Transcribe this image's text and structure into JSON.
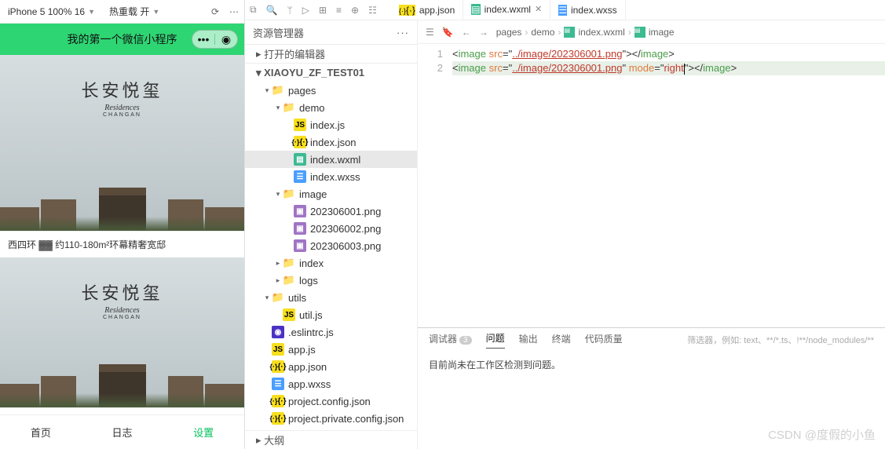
{
  "simulator": {
    "device": "iPhone 5 100% 16",
    "hotreload": "热重载 开",
    "title": "我的第一个微信小程序",
    "card_title_cn": "长安悦玺",
    "card_title_en": "Residences",
    "card_title_sub": "CHANGAN",
    "card2_caption": "西四环 ▓▓ 约110-180m²环幕精奢宽邸",
    "tabs": [
      "首页",
      "日志",
      "设置"
    ],
    "tab_active": 2
  },
  "ide_toolbar_tabs": [
    {
      "icon": "json",
      "label": "app.json",
      "active": false
    },
    {
      "icon": "wxml",
      "label": "index.wxml",
      "active": true,
      "close": true
    },
    {
      "icon": "wxss",
      "label": "index.wxss",
      "active": false
    }
  ],
  "explorer": {
    "title": "资源管理器",
    "open_editors": "打开的编辑器",
    "project": "XIAOYU_ZF_TEST01",
    "outline": "大纲",
    "tree": [
      {
        "d": 1,
        "exp": true,
        "icon": "folder-blue",
        "label": "pages"
      },
      {
        "d": 2,
        "exp": true,
        "icon": "folder-blue",
        "label": "demo"
      },
      {
        "d": 3,
        "icon": "js",
        "label": "index.js"
      },
      {
        "d": 3,
        "icon": "json",
        "label": "index.json"
      },
      {
        "d": 3,
        "icon": "wxml",
        "label": "index.wxml",
        "sel": true
      },
      {
        "d": 3,
        "icon": "wxss",
        "label": "index.wxss"
      },
      {
        "d": 2,
        "exp": true,
        "icon": "folder-teal",
        "label": "image"
      },
      {
        "d": 3,
        "icon": "png",
        "label": "202306001.png"
      },
      {
        "d": 3,
        "icon": "png",
        "label": "202306002.png"
      },
      {
        "d": 3,
        "icon": "png",
        "label": "202306003.png"
      },
      {
        "d": 2,
        "exp": false,
        "icon": "folder-gray",
        "label": "index"
      },
      {
        "d": 2,
        "exp": false,
        "icon": "folder-brown",
        "label": "logs"
      },
      {
        "d": 1,
        "exp": true,
        "icon": "folder-teal",
        "label": "utils"
      },
      {
        "d": 2,
        "icon": "js",
        "label": "util.js"
      },
      {
        "d": 1,
        "icon": "eslint",
        "label": ".eslintrc.js"
      },
      {
        "d": 1,
        "icon": "js",
        "label": "app.js"
      },
      {
        "d": 1,
        "icon": "json",
        "label": "app.json"
      },
      {
        "d": 1,
        "icon": "wxss",
        "label": "app.wxss"
      },
      {
        "d": 1,
        "icon": "json",
        "label": "project.config.json"
      },
      {
        "d": 1,
        "icon": "json",
        "label": "project.private.config.json"
      }
    ]
  },
  "breadcrumb": [
    "pages",
    "demo",
    "index.wxml",
    "image"
  ],
  "breadcrumb_icons": [
    "",
    "",
    "wxml",
    "wxml-el"
  ],
  "code_lines": [
    {
      "n": 1,
      "tokens": [
        [
          "punc",
          "<"
        ],
        [
          "tag",
          "image"
        ],
        [
          "",
          ""
        ],
        [
          "",
          " "
        ],
        [
          "attr",
          "src"
        ],
        [
          "punc",
          "="
        ],
        [
          "punc",
          "\""
        ],
        [
          "url",
          "../image/202306001.png"
        ],
        [
          "punc",
          "\""
        ],
        [
          "punc",
          ">"
        ],
        [
          "punc",
          "</"
        ],
        [
          "tag",
          "image"
        ],
        [
          "punc",
          ">"
        ]
      ]
    },
    {
      "n": 2,
      "hl": true,
      "tokens": [
        [
          "punc",
          "<"
        ],
        [
          "tag",
          "image"
        ],
        [
          "",
          " "
        ],
        [
          "attr",
          "src"
        ],
        [
          "punc",
          "="
        ],
        [
          "punc",
          "\""
        ],
        [
          "url",
          "../image/202306001.png"
        ],
        [
          "punc",
          "\""
        ],
        [
          "",
          " "
        ],
        [
          "attr",
          "mode"
        ],
        [
          "punc",
          "="
        ],
        [
          "punc",
          "\""
        ],
        [
          "str",
          "right"
        ],
        [
          "cursor",
          ""
        ],
        [
          "punc",
          "\""
        ],
        [
          "punc",
          ">"
        ],
        [
          "punc",
          "</"
        ],
        [
          "tag",
          "image"
        ],
        [
          "punc",
          ">"
        ]
      ]
    }
  ],
  "bottom_panel": {
    "tabs": [
      "调试器",
      "问题",
      "输出",
      "终端",
      "代码质量"
    ],
    "badge_on": 0,
    "badge": "3",
    "active": 1,
    "filter_placeholder": "筛选器，例如: text、**/*.ts、!**/node_modules/**",
    "message": "目前尚未在工作区检测到问题。"
  },
  "watermark": "CSDN @度假的小鱼"
}
